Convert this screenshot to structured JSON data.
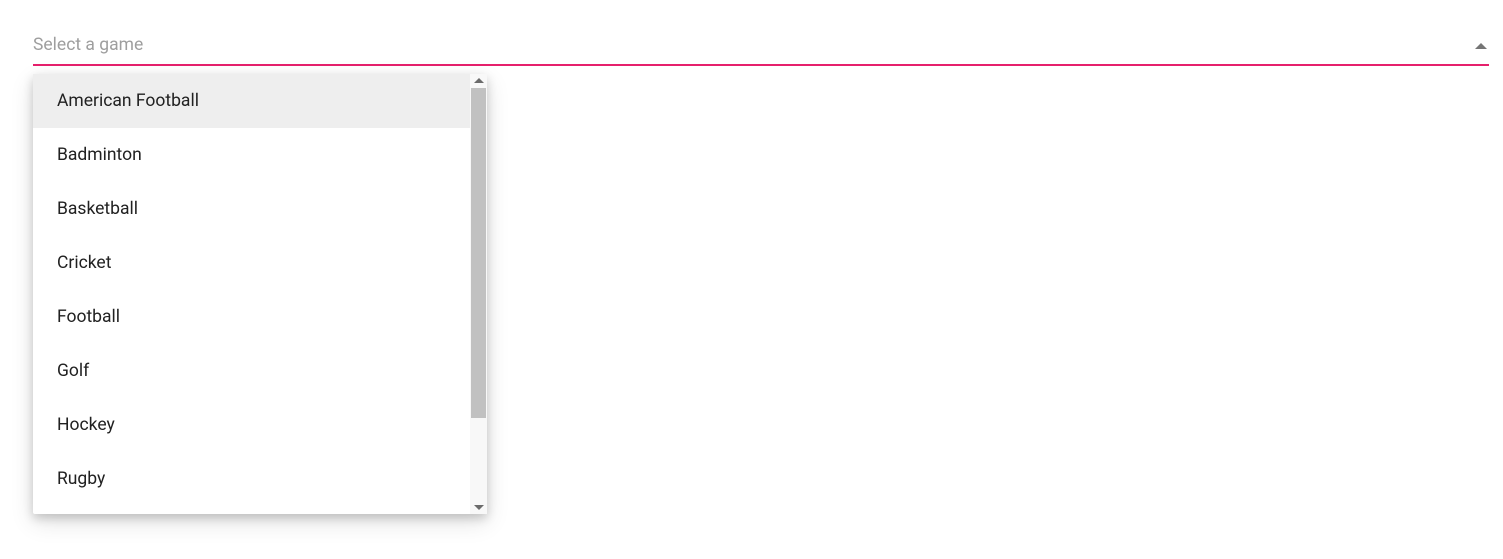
{
  "select": {
    "placeholder": "Select a game",
    "accent_color": "#e6206c",
    "expanded": true,
    "hovered_index": 0,
    "options": [
      "American Football",
      "Badminton",
      "Basketball",
      "Cricket",
      "Football",
      "Golf",
      "Hockey",
      "Rugby"
    ]
  }
}
